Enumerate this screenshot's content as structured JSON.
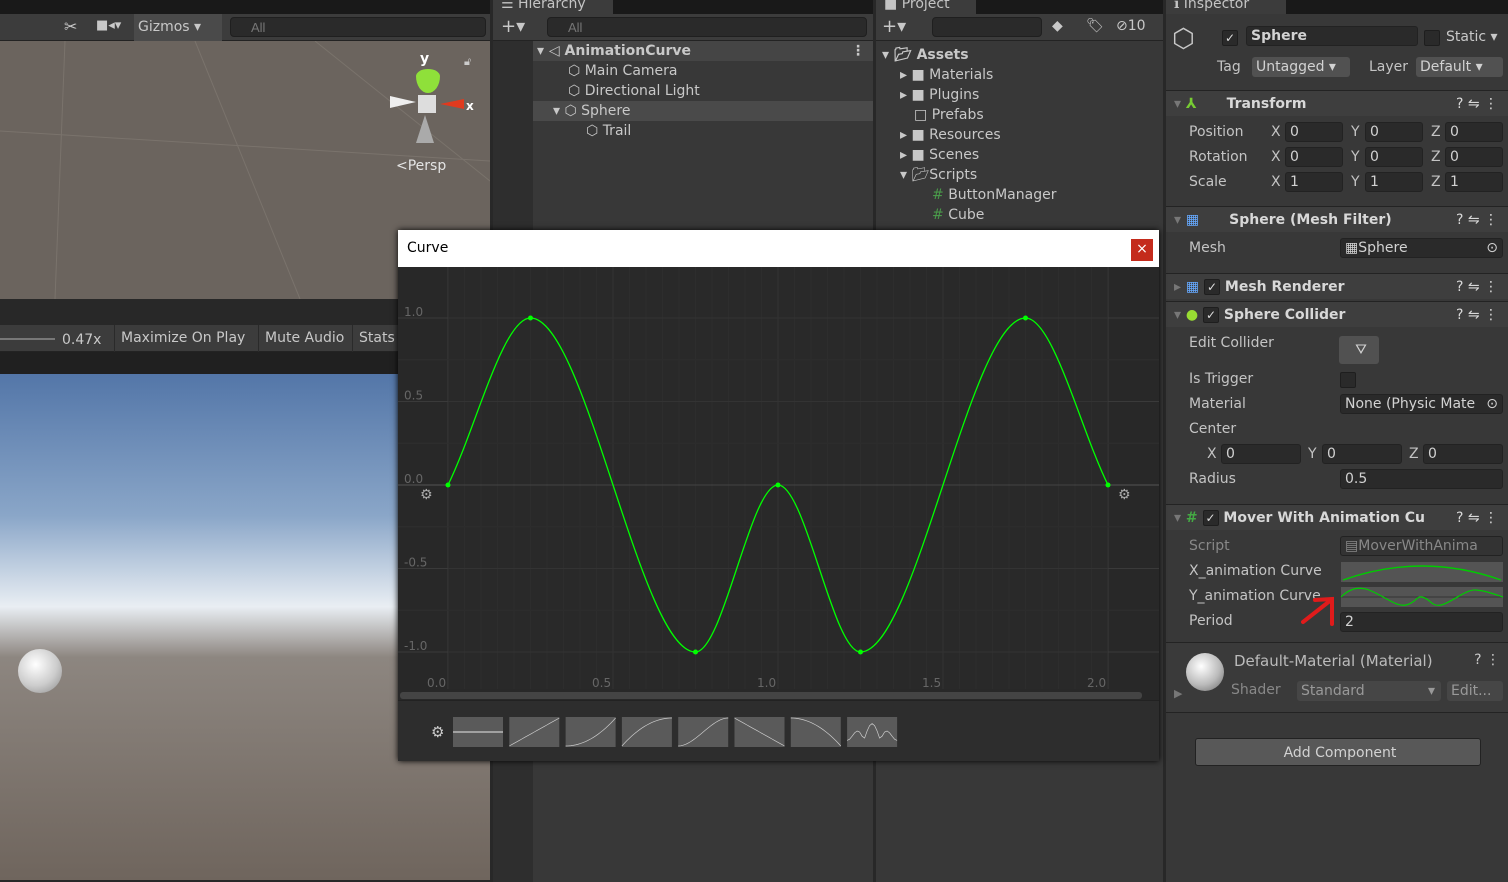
{
  "scene": {
    "gizmos": "Gizmos",
    "search_placeholder": "All",
    "axis_y": "y",
    "axis_x": "x",
    "persp": "Persp"
  },
  "game": {
    "scale": "0.47x",
    "maximize": "Maximize On Play",
    "mute": "Mute Audio",
    "stats": "Stats"
  },
  "hierarchy": {
    "tab": "Hierarchy",
    "search_placeholder": "All",
    "items": [
      {
        "label": "AnimationCurve"
      },
      {
        "label": "Main Camera"
      },
      {
        "label": "Directional Light"
      },
      {
        "label": "Sphere"
      },
      {
        "label": "Trail"
      }
    ]
  },
  "project": {
    "tab": "Project",
    "hidden_count": "10",
    "items": [
      {
        "label": "Assets"
      },
      {
        "label": "Materials"
      },
      {
        "label": "Plugins"
      },
      {
        "label": "Prefabs"
      },
      {
        "label": "Resources"
      },
      {
        "label": "Scenes"
      },
      {
        "label": "Scripts"
      },
      {
        "label": "ButtonManager"
      },
      {
        "label": "Cube"
      }
    ]
  },
  "inspector": {
    "tab": "Inspector",
    "name": "Sphere",
    "static": "Static",
    "tag_label": "Tag",
    "tag": "Untagged",
    "layer_label": "Layer",
    "layer": "Default",
    "transform": {
      "title": "Transform",
      "rows": [
        {
          "label": "Position",
          "x": "0",
          "y": "0",
          "z": "0"
        },
        {
          "label": "Rotation",
          "x": "0",
          "y": "0",
          "z": "0"
        },
        {
          "label": "Scale",
          "x": "1",
          "y": "1",
          "z": "1"
        }
      ]
    },
    "mesh_filter": {
      "title": "Sphere (Mesh Filter)",
      "mesh_label": "Mesh",
      "mesh": "Sphere"
    },
    "mesh_renderer": {
      "title": "Mesh Renderer"
    },
    "collider": {
      "title": "Sphere Collider",
      "edit": "Edit Collider",
      "trigger": "Is Trigger",
      "material_label": "Material",
      "material": "None (Physic Mate",
      "center": "Center",
      "cx": "0",
      "cy": "0",
      "cz": "0",
      "radius_label": "Radius",
      "radius": "0.5"
    },
    "mover": {
      "title": "Mover With Animation Cu",
      "script_label": "Script",
      "script": "MoverWithAnima",
      "xcurve": "X_animation Curve",
      "ycurve": "Y_animation Curve",
      "period_label": "Period",
      "period": "2"
    },
    "material": {
      "title": "Default-Material (Material)",
      "shader_label": "Shader",
      "shader": "Standard",
      "edit": "Edit..."
    },
    "add_component": "Add Component",
    "axis_labels": {
      "x": "X",
      "y": "Y",
      "z": "Z"
    }
  },
  "curve_window": {
    "title": "Curve",
    "close": "×",
    "chart_data": {
      "type": "line",
      "curve_color": "#00ff00",
      "xlim": [
        0,
        2
      ],
      "ylim": [
        -1,
        1
      ],
      "x_ticks": [
        "0.0",
        "0.5",
        "1.0",
        "1.5",
        "2.0"
      ],
      "y_ticks": [
        "1.0",
        "0.5",
        "0.0",
        "-0.5",
        "-1.0"
      ],
      "keys": [
        [
          0,
          0
        ],
        [
          0.25,
          1
        ],
        [
          0.75,
          -1
        ],
        [
          1.0,
          0
        ],
        [
          1.25,
          -1
        ],
        [
          1.75,
          1
        ],
        [
          2.0,
          0
        ]
      ]
    }
  }
}
